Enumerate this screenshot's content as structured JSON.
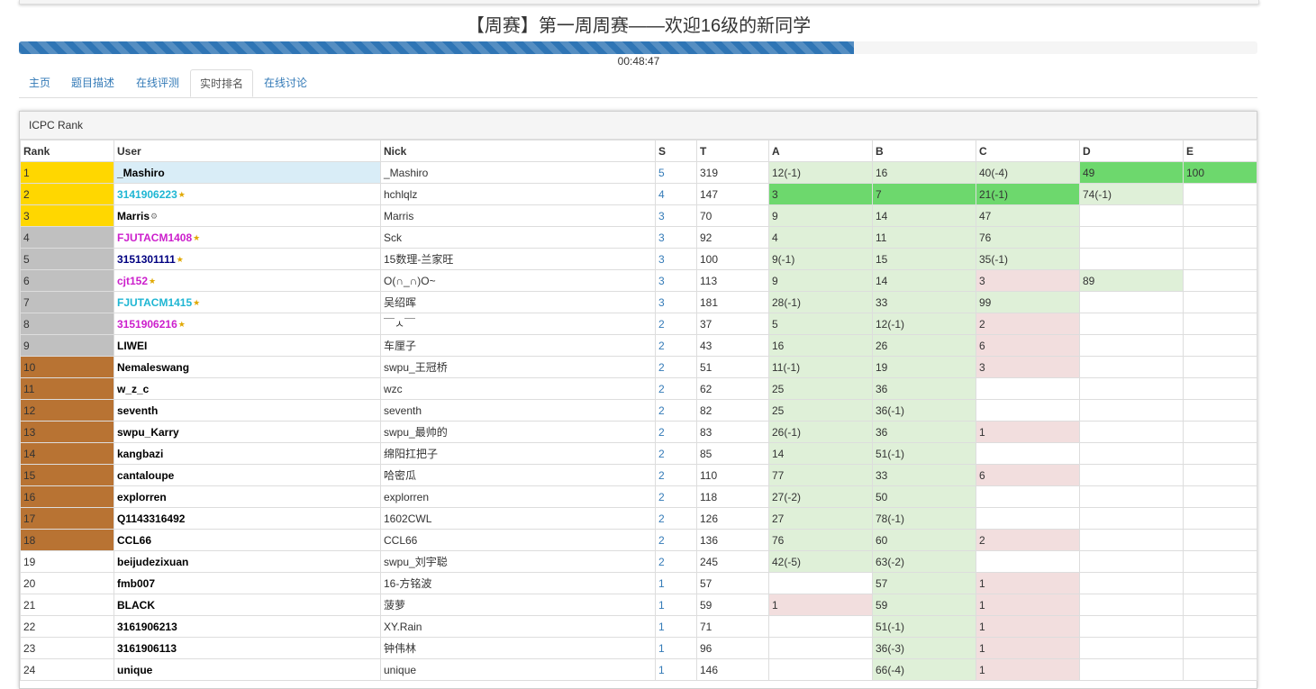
{
  "page": {
    "title": "【周赛】第一周周赛——欢迎16级的新同学",
    "progress": 0.674,
    "timer": "00:48:47"
  },
  "tabs": [
    {
      "label": "主页"
    },
    {
      "label": "题目描述"
    },
    {
      "label": "在线评测"
    },
    {
      "label": "实时排名",
      "active": true
    },
    {
      "label": "在线讨论"
    }
  ],
  "panel": {
    "heading": "ICPC Rank"
  },
  "colors": {
    "gold": "#ffd700",
    "silver": "#c0c0c0",
    "bronze": "#b87333",
    "first_blood": "#6dd86d",
    "solved": "#dff0d8",
    "tried": "#f2dede",
    "self_user": "#d9edf7",
    "link": "#337ab7",
    "cyan_user": "#1fb6d3",
    "magenta_user": "#cc1fcc",
    "navy_user": "#000080"
  },
  "table": {
    "headers": [
      "Rank",
      "User",
      "Nick",
      "S",
      "T",
      "A",
      "B",
      "C",
      "D",
      "E"
    ],
    "rows": [
      {
        "rank": "1",
        "user": "_Mashiro",
        "nick": "_Mashiro",
        "s": "5",
        "t": "319",
        "medal": "gold",
        "user_color": "",
        "badge": false,
        "self": true,
        "cells": [
          {
            "v": "12(-1)",
            "st": "solved"
          },
          {
            "v": "16",
            "st": "solved"
          },
          {
            "v": "40(-4)",
            "st": "solved"
          },
          {
            "v": "49",
            "st": "first"
          },
          {
            "v": "100",
            "st": "first"
          }
        ]
      },
      {
        "rank": "2",
        "user": "3141906223",
        "nick": "hchlqlz",
        "s": "4",
        "t": "147",
        "medal": "gold",
        "user_color": "cyan",
        "badge": true,
        "cells": [
          {
            "v": "3",
            "st": "first"
          },
          {
            "v": "7",
            "st": "first"
          },
          {
            "v": "21(-1)",
            "st": "first"
          },
          {
            "v": "74(-1)",
            "st": "solved"
          },
          {
            "v": "",
            "st": ""
          }
        ]
      },
      {
        "rank": "3",
        "user": "Marris",
        "nick": "Marris",
        "s": "3",
        "t": "70",
        "medal": "gold",
        "user_color": "",
        "badge": true,
        "cells": [
          {
            "v": "9",
            "st": "solved"
          },
          {
            "v": "14",
            "st": "solved"
          },
          {
            "v": "47",
            "st": "solved"
          },
          {
            "v": "",
            "st": ""
          },
          {
            "v": "",
            "st": ""
          }
        ]
      },
      {
        "rank": "4",
        "user": "FJUTACM1408",
        "nick": "Sck",
        "s": "3",
        "t": "92",
        "medal": "silver",
        "user_color": "magenta",
        "badge": true,
        "cells": [
          {
            "v": "4",
            "st": "solved"
          },
          {
            "v": "11",
            "st": "solved"
          },
          {
            "v": "76",
            "st": "solved"
          },
          {
            "v": "",
            "st": ""
          },
          {
            "v": "",
            "st": ""
          }
        ]
      },
      {
        "rank": "5",
        "user": "3151301111",
        "nick": "15数理-兰家旺",
        "s": "3",
        "t": "100",
        "medal": "silver",
        "user_color": "navy",
        "badge": true,
        "cells": [
          {
            "v": "9(-1)",
            "st": "solved"
          },
          {
            "v": "15",
            "st": "solved"
          },
          {
            "v": "35(-1)",
            "st": "solved"
          },
          {
            "v": "",
            "st": ""
          },
          {
            "v": "",
            "st": ""
          }
        ]
      },
      {
        "rank": "6",
        "user": "cjt152",
        "nick": "O(∩_∩)O~",
        "s": "3",
        "t": "113",
        "medal": "silver",
        "user_color": "magenta",
        "badge": true,
        "cells": [
          {
            "v": "9",
            "st": "solved"
          },
          {
            "v": "14",
            "st": "solved"
          },
          {
            "v": "3",
            "st": "tried"
          },
          {
            "v": "89",
            "st": "solved"
          },
          {
            "v": "",
            "st": ""
          }
        ]
      },
      {
        "rank": "7",
        "user": "FJUTACM1415",
        "nick": "吴绍晖",
        "s": "3",
        "t": "181",
        "medal": "silver",
        "user_color": "cyan",
        "badge": true,
        "cells": [
          {
            "v": "28(-1)",
            "st": "solved"
          },
          {
            "v": "33",
            "st": "solved"
          },
          {
            "v": "99",
            "st": "solved"
          },
          {
            "v": "",
            "st": ""
          },
          {
            "v": "",
            "st": ""
          }
        ]
      },
      {
        "rank": "8",
        "user": "3151906216",
        "nick": "￣ㅅ￣",
        "s": "2",
        "t": "37",
        "medal": "silver",
        "user_color": "magenta",
        "badge": true,
        "cells": [
          {
            "v": "5",
            "st": "solved"
          },
          {
            "v": "12(-1)",
            "st": "solved"
          },
          {
            "v": "2",
            "st": "tried"
          },
          {
            "v": "",
            "st": ""
          },
          {
            "v": "",
            "st": ""
          }
        ]
      },
      {
        "rank": "9",
        "user": "LIWEI",
        "nick": "车厘子",
        "s": "2",
        "t": "43",
        "medal": "silver",
        "user_color": "",
        "badge": false,
        "cells": [
          {
            "v": "16",
            "st": "solved"
          },
          {
            "v": "26",
            "st": "solved"
          },
          {
            "v": "6",
            "st": "tried"
          },
          {
            "v": "",
            "st": ""
          },
          {
            "v": "",
            "st": ""
          }
        ]
      },
      {
        "rank": "10",
        "user": "Nemaleswang",
        "nick": "swpu_王冠桥",
        "s": "2",
        "t": "51",
        "medal": "bronze",
        "user_color": "",
        "badge": false,
        "cells": [
          {
            "v": "11(-1)",
            "st": "solved"
          },
          {
            "v": "19",
            "st": "solved"
          },
          {
            "v": "3",
            "st": "tried"
          },
          {
            "v": "",
            "st": ""
          },
          {
            "v": "",
            "st": ""
          }
        ]
      },
      {
        "rank": "11",
        "user": "w_z_c",
        "nick": "wzc",
        "s": "2",
        "t": "62",
        "medal": "bronze",
        "user_color": "",
        "badge": false,
        "cells": [
          {
            "v": "25",
            "st": "solved"
          },
          {
            "v": "36",
            "st": "solved"
          },
          {
            "v": "",
            "st": ""
          },
          {
            "v": "",
            "st": ""
          },
          {
            "v": "",
            "st": ""
          }
        ]
      },
      {
        "rank": "12",
        "user": "seventh",
        "nick": "seventh",
        "s": "2",
        "t": "82",
        "medal": "bronze",
        "user_color": "",
        "badge": false,
        "cells": [
          {
            "v": "25",
            "st": "solved"
          },
          {
            "v": "36(-1)",
            "st": "solved"
          },
          {
            "v": "",
            "st": ""
          },
          {
            "v": "",
            "st": ""
          },
          {
            "v": "",
            "st": ""
          }
        ]
      },
      {
        "rank": "13",
        "user": "swpu_Karry",
        "nick": "swpu_最帅的",
        "s": "2",
        "t": "83",
        "medal": "bronze",
        "user_color": "",
        "badge": false,
        "cells": [
          {
            "v": "26(-1)",
            "st": "solved"
          },
          {
            "v": "36",
            "st": "solved"
          },
          {
            "v": "1",
            "st": "tried"
          },
          {
            "v": "",
            "st": ""
          },
          {
            "v": "",
            "st": ""
          }
        ]
      },
      {
        "rank": "14",
        "user": "kangbazi",
        "nick": "绵阳扛把子",
        "s": "2",
        "t": "85",
        "medal": "bronze",
        "user_color": "",
        "badge": false,
        "cells": [
          {
            "v": "14",
            "st": "solved"
          },
          {
            "v": "51(-1)",
            "st": "solved"
          },
          {
            "v": "",
            "st": ""
          },
          {
            "v": "",
            "st": ""
          },
          {
            "v": "",
            "st": ""
          }
        ]
      },
      {
        "rank": "15",
        "user": "cantaloupe",
        "nick": "哈密瓜",
        "s": "2",
        "t": "110",
        "medal": "bronze",
        "user_color": "",
        "badge": false,
        "cells": [
          {
            "v": "77",
            "st": "solved"
          },
          {
            "v": "33",
            "st": "solved"
          },
          {
            "v": "6",
            "st": "tried"
          },
          {
            "v": "",
            "st": ""
          },
          {
            "v": "",
            "st": ""
          }
        ]
      },
      {
        "rank": "16",
        "user": "explorren",
        "nick": "explorren",
        "s": "2",
        "t": "118",
        "medal": "bronze",
        "user_color": "",
        "badge": false,
        "cells": [
          {
            "v": "27(-2)",
            "st": "solved"
          },
          {
            "v": "50",
            "st": "solved"
          },
          {
            "v": "",
            "st": ""
          },
          {
            "v": "",
            "st": ""
          },
          {
            "v": "",
            "st": ""
          }
        ]
      },
      {
        "rank": "17",
        "user": "Q1143316492",
        "nick": "1602CWL",
        "s": "2",
        "t": "126",
        "medal": "bronze",
        "user_color": "",
        "badge": false,
        "cells": [
          {
            "v": "27",
            "st": "solved"
          },
          {
            "v": "78(-1)",
            "st": "solved"
          },
          {
            "v": "",
            "st": ""
          },
          {
            "v": "",
            "st": ""
          },
          {
            "v": "",
            "st": ""
          }
        ]
      },
      {
        "rank": "18",
        "user": "CCL66",
        "nick": "CCL66",
        "s": "2",
        "t": "136",
        "medal": "bronze",
        "user_color": "",
        "badge": false,
        "cells": [
          {
            "v": "76",
            "st": "solved"
          },
          {
            "v": "60",
            "st": "solved"
          },
          {
            "v": "2",
            "st": "tried"
          },
          {
            "v": "",
            "st": ""
          },
          {
            "v": "",
            "st": ""
          }
        ]
      },
      {
        "rank": "19",
        "user": "beijudezixuan",
        "nick": "swpu_刘宇聪",
        "s": "2",
        "t": "245",
        "medal": "",
        "user_color": "",
        "badge": false,
        "cells": [
          {
            "v": "42(-5)",
            "st": "solved"
          },
          {
            "v": "63(-2)",
            "st": "solved"
          },
          {
            "v": "",
            "st": ""
          },
          {
            "v": "",
            "st": ""
          },
          {
            "v": "",
            "st": ""
          }
        ]
      },
      {
        "rank": "20",
        "user": "fmb007",
        "nick": "16-方铭波",
        "s": "1",
        "t": "57",
        "medal": "",
        "user_color": "",
        "badge": false,
        "cells": [
          {
            "v": "",
            "st": ""
          },
          {
            "v": "57",
            "st": "solved"
          },
          {
            "v": "1",
            "st": "tried"
          },
          {
            "v": "",
            "st": ""
          },
          {
            "v": "",
            "st": ""
          }
        ]
      },
      {
        "rank": "21",
        "user": "BLACK",
        "nick": "菠萝",
        "s": "1",
        "t": "59",
        "medal": "",
        "user_color": "",
        "badge": false,
        "cells": [
          {
            "v": "1",
            "st": "tried"
          },
          {
            "v": "59",
            "st": "solved"
          },
          {
            "v": "1",
            "st": "tried"
          },
          {
            "v": "",
            "st": ""
          },
          {
            "v": "",
            "st": ""
          }
        ]
      },
      {
        "rank": "22",
        "user": "3161906213",
        "nick": "XY.Rain",
        "s": "1",
        "t": "71",
        "medal": "",
        "user_color": "",
        "badge": false,
        "cells": [
          {
            "v": "",
            "st": ""
          },
          {
            "v": "51(-1)",
            "st": "solved"
          },
          {
            "v": "1",
            "st": "tried"
          },
          {
            "v": "",
            "st": ""
          },
          {
            "v": "",
            "st": ""
          }
        ]
      },
      {
        "rank": "23",
        "user": "3161906113",
        "nick": "钟伟林",
        "s": "1",
        "t": "96",
        "medal": "",
        "user_color": "",
        "badge": false,
        "cells": [
          {
            "v": "",
            "st": ""
          },
          {
            "v": "36(-3)",
            "st": "solved"
          },
          {
            "v": "1",
            "st": "tried"
          },
          {
            "v": "",
            "st": ""
          },
          {
            "v": "",
            "st": ""
          }
        ]
      },
      {
        "rank": "24",
        "user": "unique",
        "nick": "unique",
        "s": "1",
        "t": "146",
        "medal": "",
        "user_color": "",
        "badge": false,
        "cells": [
          {
            "v": "",
            "st": ""
          },
          {
            "v": "66(-4)",
            "st": "solved"
          },
          {
            "v": "1",
            "st": "tried"
          },
          {
            "v": "",
            "st": ""
          },
          {
            "v": "",
            "st": ""
          }
        ]
      }
    ]
  }
}
